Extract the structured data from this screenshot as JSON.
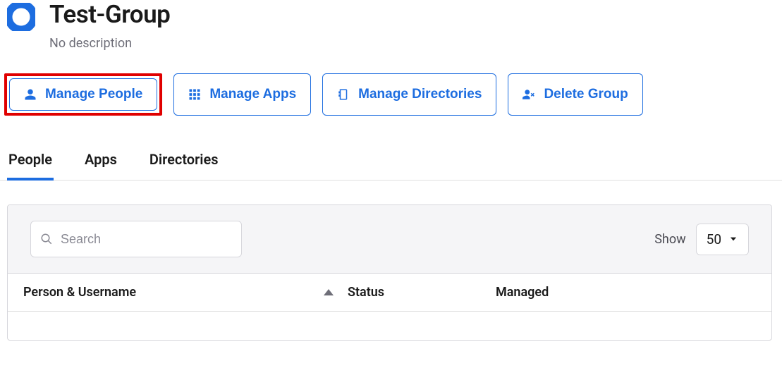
{
  "header": {
    "title": "Test-Group",
    "subtitle": "No description"
  },
  "actions": {
    "manage_people": "Manage People",
    "manage_apps": "Manage Apps",
    "manage_directories": "Manage Directories",
    "delete_group": "Delete Group"
  },
  "tabs": {
    "people": "People",
    "apps": "Apps",
    "directories": "Directories",
    "active": "people"
  },
  "search": {
    "placeholder": "Search",
    "value": ""
  },
  "show": {
    "label": "Show",
    "selected": "50"
  },
  "columns": {
    "person": "Person & Username",
    "status": "Status",
    "managed": "Managed"
  },
  "colors": {
    "primary": "#1d6de0",
    "highlight": "#e00000"
  }
}
